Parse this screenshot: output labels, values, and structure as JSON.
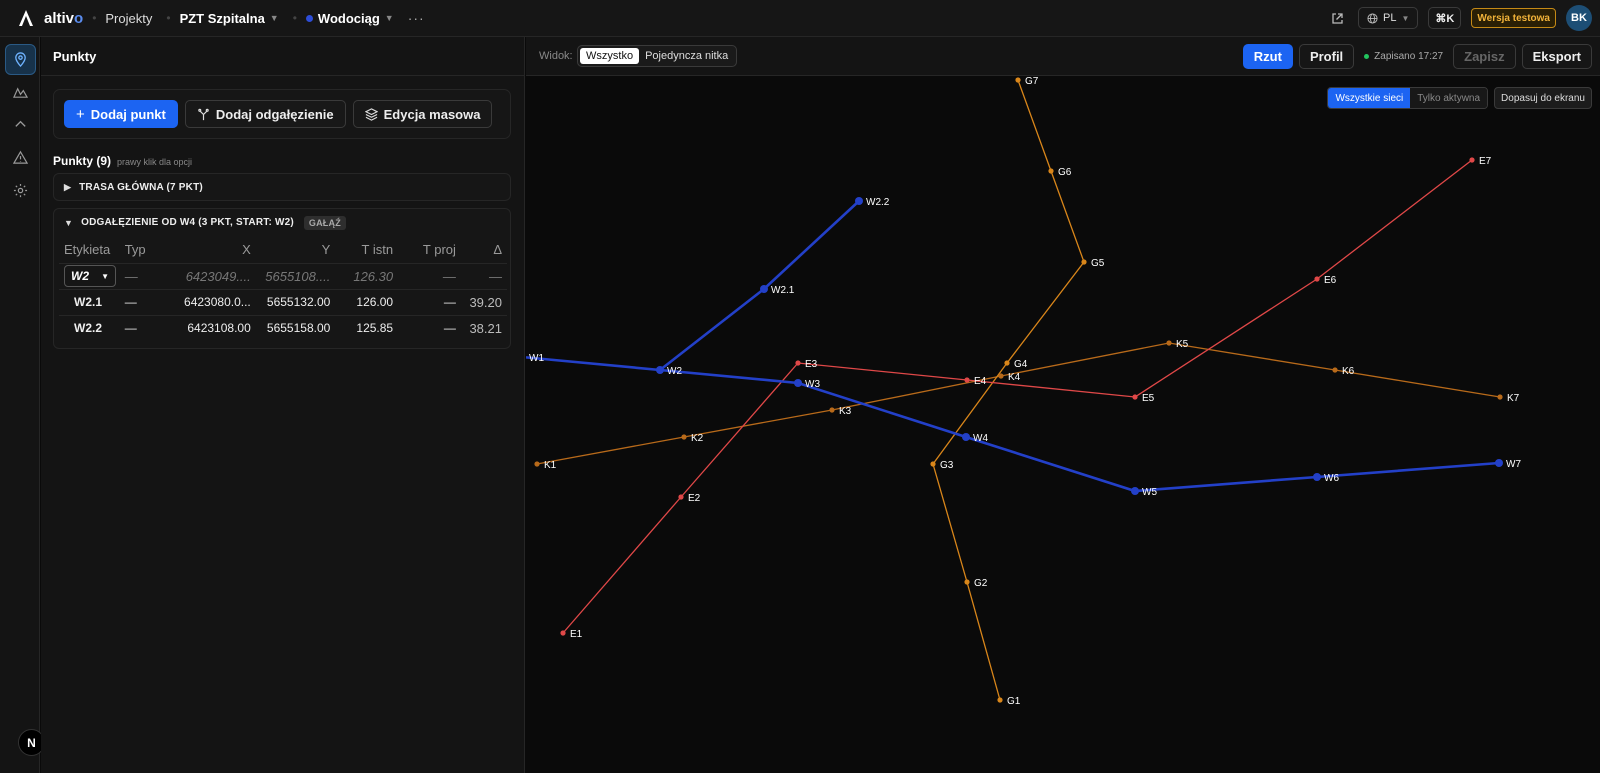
{
  "app": {
    "name_main": "altiv",
    "name_accent": "o"
  },
  "topbar": {
    "projects_link": "Projekty",
    "project_name": "PZT Szpitalna",
    "network_name": "Wodociąg",
    "more": "···",
    "lang": "PL",
    "shortcut": "⌘K",
    "test_badge": "Wersja testowa",
    "avatar": "BK"
  },
  "panel": {
    "title": "Punkty",
    "add_point": "Dodaj punkt",
    "add_branch": "Dodaj odgałęzienie",
    "bulk_edit": "Edycja masowa",
    "points_title": "Punkty (9)",
    "points_hint": "prawy klik dla opcji",
    "group_main": "TRASA GŁÓWNA (7 PKT)",
    "group_branch": "ODGAŁĘZIENIE OD W4 (3 PKT, START: W2)",
    "branch_tag": "GAŁĄŹ",
    "table": {
      "headers": [
        "Etykieta",
        "Typ",
        "X",
        "Y",
        "T istn",
        "T proj",
        "Δ"
      ],
      "start": {
        "select": "W2",
        "typ": "—",
        "x": "6423049....",
        "y": "5655108....",
        "t_istn": "126.30",
        "t_proj": "—",
        "delta": "—"
      },
      "rows": [
        {
          "label": "W2.1",
          "typ": "—",
          "x": "6423080.0...",
          "y": "5655132.00",
          "t_istn": "126.00",
          "t_proj": "—",
          "delta": "39.20"
        },
        {
          "label": "W2.2",
          "typ": "—",
          "x": "6423108.00",
          "y": "5655158.00",
          "t_istn": "125.85",
          "t_proj": "—",
          "delta": "38.21"
        }
      ]
    }
  },
  "map_toolbar": {
    "view_label": "Widok:",
    "view_all": "Wszystko",
    "view_single": "Pojedyncza nitka",
    "plan": "Rzut",
    "profile": "Profil",
    "saved": "Zapisano 17:27",
    "save": "Zapisz",
    "export": "Eksport"
  },
  "map_controls": {
    "all_networks": "Wszystkie sieci",
    "only_active": "Tylko aktywna",
    "fit": "Dopasuj do ekranu"
  },
  "colors": {
    "water": "#2340c8",
    "gas": "#d9861a",
    "power": "#e04848",
    "sewer": "#b86a1a",
    "accent": "#1c64f2"
  },
  "networks": [
    {
      "id": "W",
      "color": "#2340c8",
      "main": true,
      "points": [
        [
          "W1",
          -4,
          280
        ],
        [
          "W2",
          134,
          293
        ],
        [
          "W3",
          272,
          306
        ],
        [
          "W4",
          440,
          360
        ],
        [
          "W5",
          609,
          414
        ],
        [
          "W6",
          791,
          400
        ],
        [
          "W7",
          973,
          386
        ]
      ],
      "branch": [
        [
          "W2",
          134,
          293
        ],
        [
          "W2.1",
          238,
          212
        ],
        [
          "W2.2",
          333,
          124
        ]
      ]
    },
    {
      "id": "G",
      "color": "#d9861a",
      "points": [
        [
          "G1",
          474,
          623
        ],
        [
          "G2",
          441,
          505
        ],
        [
          "G3",
          407,
          387
        ],
        [
          "G4",
          481,
          286
        ],
        [
          "G5",
          558,
          185
        ],
        [
          "G6",
          525,
          94
        ],
        [
          "G7",
          492,
          3
        ]
      ]
    },
    {
      "id": "E",
      "color": "#e04848",
      "points": [
        [
          "E1",
          37,
          556
        ],
        [
          "E2",
          155,
          420
        ],
        [
          "E3",
          272,
          286
        ],
        [
          "E4",
          441,
          303
        ],
        [
          "E5",
          609,
          320
        ],
        [
          "E6",
          791,
          202
        ],
        [
          "E7",
          946,
          83
        ]
      ]
    },
    {
      "id": "K",
      "color": "#b86a1a",
      "points": [
        [
          "K1",
          11,
          387
        ],
        [
          "K2",
          158,
          360
        ],
        [
          "K3",
          306,
          333
        ],
        [
          "K4",
          475,
          299
        ],
        [
          "K5",
          643,
          266
        ],
        [
          "K6",
          809,
          293
        ],
        [
          "K7",
          974,
          320
        ]
      ]
    }
  ]
}
